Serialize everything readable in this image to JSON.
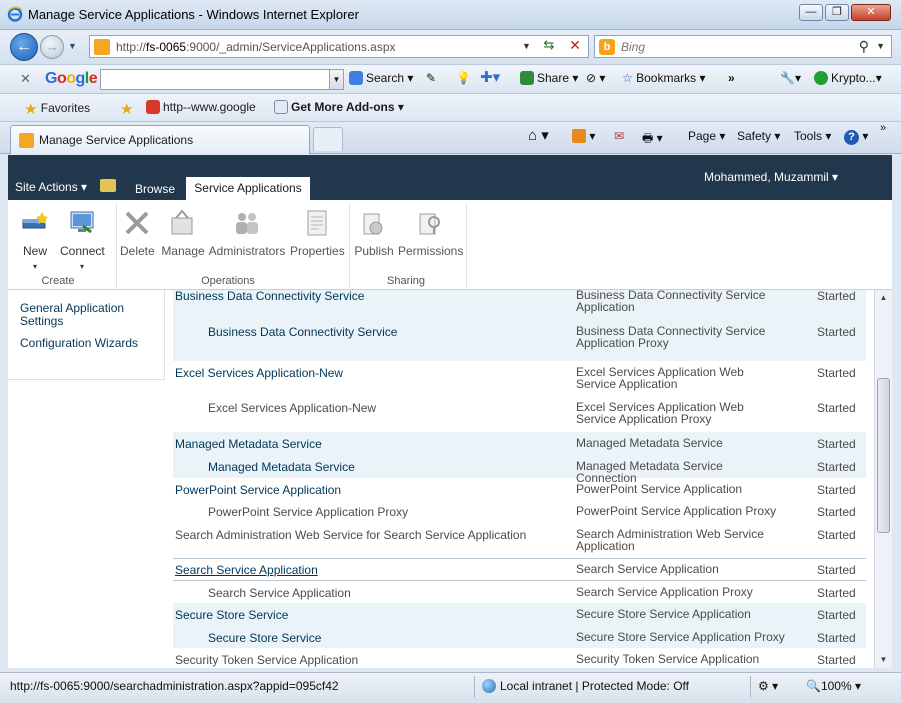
{
  "window": {
    "title": "Manage Service Applications - Windows Internet Explorer",
    "minimize": "—",
    "restore": "❐",
    "close": "✕"
  },
  "address": {
    "url_prefix": "http://",
    "url_host": "fs-0065",
    "url_rest": ":9000/_admin/ServiceApplications.aspx",
    "search_placeholder": "Bing"
  },
  "google_toolbar": {
    "logo": "Google",
    "search_label": "Search",
    "share_label": "Share",
    "bookmarks_label": "Bookmarks",
    "more": "»",
    "kryptos_label": "Krypto..."
  },
  "favorites_bar": {
    "favorites_label": "Favorites",
    "link1": "http--www.google",
    "link2": "Get More Add-ons"
  },
  "tabs": {
    "active_label": "Manage Service Applications"
  },
  "command_bar": {
    "page": "Page",
    "safety": "Safety",
    "tools": "Tools",
    "help": "?",
    "more": "»"
  },
  "sharepoint": {
    "site_actions": "Site Actions",
    "browse": "Browse",
    "active_tab": "Service Applications",
    "user": "Mohammed, Muzammil"
  },
  "ribbon": {
    "new": "New",
    "connect": "Connect",
    "delete": "Delete",
    "manage": "Manage",
    "administrators": "Administrators",
    "properties": "Properties",
    "publish": "Publish",
    "permissions": "Permissions",
    "group_create": "Create",
    "group_operations": "Operations",
    "group_sharing": "Sharing"
  },
  "quick_launch": [
    "General Application Settings",
    "Configuration Wizards"
  ],
  "rows": [
    {
      "name": "Business Data Connectivity Service",
      "type": "Business Data Connectivity Service Application",
      "status": "Started"
    },
    {
      "name": "Business Data Connectivity Service",
      "type": "Business Data Connectivity Service Application Proxy",
      "status": "Started"
    },
    {
      "name": "Excel Services Application-New",
      "type": "Excel Services Application Web Service Application",
      "status": "Started"
    },
    {
      "name": "Excel Services Application-New",
      "type": "Excel Services Application Web Service Application Proxy",
      "status": "Started"
    },
    {
      "name": "Managed Metadata Service",
      "type": "Managed Metadata Service",
      "status": "Started"
    },
    {
      "name": "Managed Metadata Service",
      "type": "Managed Metadata Service Connection",
      "status": "Started"
    },
    {
      "name": "PowerPoint Service Application",
      "type": "PowerPoint Service Application",
      "status": "Started"
    },
    {
      "name": "PowerPoint Service Application Proxy",
      "type": "PowerPoint Service Application Proxy",
      "status": "Started"
    },
    {
      "name": "Search Administration Web Service for Search Service Application",
      "type": "Search Administration Web Service Application",
      "status": "Started"
    },
    {
      "name": "Search Service Application",
      "type": "Search Service Application",
      "status": "Started"
    },
    {
      "name": "Search Service Application",
      "type": "Search Service Application Proxy",
      "status": "Started"
    },
    {
      "name": "Secure Store Service",
      "type": "Secure Store Service Application",
      "status": "Started"
    },
    {
      "name": "Secure Store Service",
      "type": "Secure Store Service Application Proxy",
      "status": "Started"
    },
    {
      "name": "Security Token Service Application",
      "type": "Security Token Service Application",
      "status": "Started"
    }
  ],
  "statusbar": {
    "link_preview": "http://fs-0065:9000/searchadministration.aspx?appid=095cf42",
    "zone": "Local intranet | Protected Mode: Off",
    "zoom": "100%"
  }
}
